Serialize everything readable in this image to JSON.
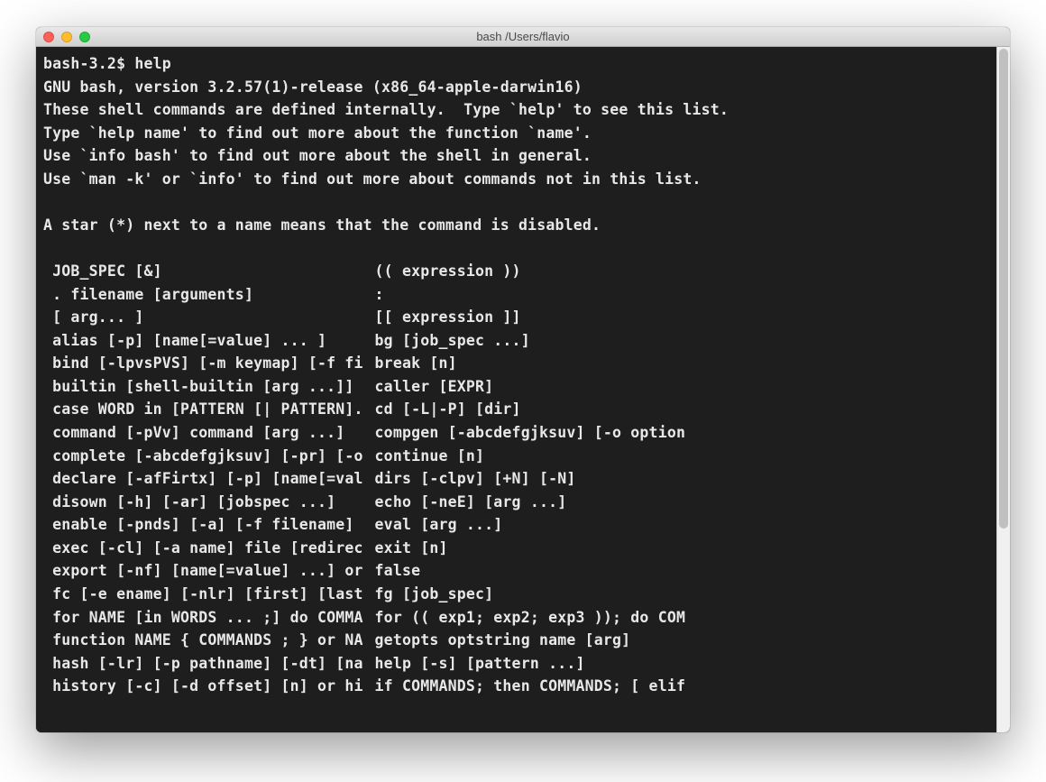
{
  "window": {
    "title": "bash   /Users/flavio"
  },
  "prompt": "bash-3.2$ ",
  "command": "help",
  "output_header": [
    "GNU bash, version 3.2.57(1)-release (x86_64-apple-darwin16)",
    "These shell commands are defined internally.  Type `help' to see this list.",
    "Type `help name' to find out more about the function `name'.",
    "Use `info bash' to find out more about the shell in general.",
    "Use `man -k' or `info' to find out more about commands not in this list.",
    "",
    "A star (*) next to a name means that the command is disabled.",
    ""
  ],
  "help_columns": [
    {
      "left": " JOB_SPEC [&]",
      "right": "(( expression ))"
    },
    {
      "left": " . filename [arguments]",
      "right": ":"
    },
    {
      "left": " [ arg... ]",
      "right": "[[ expression ]]"
    },
    {
      "left": " alias [-p] [name[=value] ... ]",
      "right": "bg [job_spec ...]"
    },
    {
      "left": " bind [-lpvsPVS] [-m keymap] [-f fi",
      "right": "break [n]"
    },
    {
      "left": " builtin [shell-builtin [arg ...]]",
      "right": "caller [EXPR]"
    },
    {
      "left": " case WORD in [PATTERN [| PATTERN].",
      "right": "cd [-L|-P] [dir]"
    },
    {
      "left": " command [-pVv] command [arg ...]",
      "right": "compgen [-abcdefgjksuv] [-o option"
    },
    {
      "left": " complete [-abcdefgjksuv] [-pr] [-o",
      "right": "continue [n]"
    },
    {
      "left": " declare [-afFirtx] [-p] [name[=val",
      "right": "dirs [-clpv] [+N] [-N]"
    },
    {
      "left": " disown [-h] [-ar] [jobspec ...]",
      "right": "echo [-neE] [arg ...]"
    },
    {
      "left": " enable [-pnds] [-a] [-f filename]",
      "right": "eval [arg ...]"
    },
    {
      "left": " exec [-cl] [-a name] file [redirec",
      "right": "exit [n]"
    },
    {
      "left": " export [-nf] [name[=value] ...] or",
      "right": "false"
    },
    {
      "left": " fc [-e ename] [-nlr] [first] [last",
      "right": "fg [job_spec]"
    },
    {
      "left": " for NAME [in WORDS ... ;] do COMMA",
      "right": "for (( exp1; exp2; exp3 )); do COM"
    },
    {
      "left": " function NAME { COMMANDS ; } or NA",
      "right": "getopts optstring name [arg]"
    },
    {
      "left": " hash [-lr] [-p pathname] [-dt] [na",
      "right": "help [-s] [pattern ...]"
    },
    {
      "left": " history [-c] [-d offset] [n] or hi",
      "right": "if COMMANDS; then COMMANDS; [ elif"
    }
  ]
}
